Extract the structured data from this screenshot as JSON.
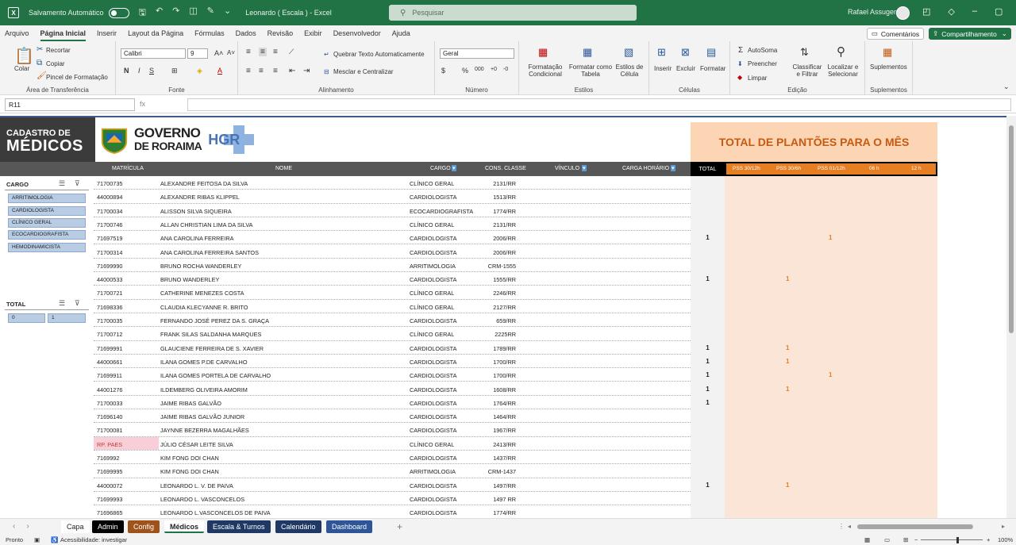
{
  "titlebar": {
    "app_icon": "excel-icon",
    "autosave": "Salvamento Automático",
    "doc_title": "Leonardo ( Escala )  -  Excel",
    "search_placeholder": "Pesquisar",
    "user": "Rafael Assugeni"
  },
  "menu": {
    "items": [
      "Arquivo",
      "Página Inicial",
      "Inserir",
      "Layout da Página",
      "Fórmulas",
      "Dados",
      "Revisão",
      "Exibir",
      "Desenvolvedor",
      "Ajuda"
    ],
    "active": "Página Inicial",
    "comments": "Comentários",
    "share": "Compartilhamento"
  },
  "ribbon": {
    "clipboard": {
      "name": "Área de Transferência",
      "paste": "Colar",
      "cut": "Recortar",
      "copy": "Copiar",
      "format_painter": "Pincel de Formatação"
    },
    "font": {
      "name": "Fonte",
      "family": "Calibri",
      "size": "9"
    },
    "alignment": {
      "name": "Alinhamento",
      "wrap": "Quebrar Texto Automaticamente",
      "merge": "Mesclar e Centralizar"
    },
    "number": {
      "name": "Número",
      "format": "Geral"
    },
    "styles": {
      "name": "Estilos",
      "conditional": "Formatação Condicional",
      "as_table": "Formatar como Tabela",
      "cell_styles": "Estilos de Célula"
    },
    "cells": {
      "name": "Células",
      "insert": "Inserir",
      "delete": "Excluir",
      "format": "Formatar"
    },
    "editing": {
      "name": "Edição",
      "autosum": "AutoSoma",
      "fill": "Preencher",
      "clear": "Limpar",
      "sort": "Classificar e Filtrar",
      "find": "Localizar e Selecionar"
    },
    "addins": {
      "name": "Suplementos",
      "label": "Suplementos"
    }
  },
  "formula": {
    "cell": "R11",
    "fx": "fx",
    "value": ""
  },
  "sheet": {
    "brand_l1": "CADASTRO DE",
    "brand_l2": "MÉDICOS",
    "gov_l1": "GOVERNO",
    "gov_l2": "DE RORAIMA",
    "hgr": "HGR",
    "plantoes_title": "TOTAL DE PLANTÕES PARA O MÊS",
    "headers": {
      "matricula": "MATRÍCULA",
      "nome": "NOME",
      "cargo": "CARGO",
      "cons_classe": "CONS. CLASSE",
      "vinculo": "VÍNCULO",
      "carga": "CARGA HORÁRIO",
      "total": "TOTAL",
      "pss30_12": "PSS 30/12h",
      "pss30_6": "PSS 30/6h",
      "pss01_12": "PSS 01/12h",
      "h06": "06 h",
      "h12": "12 h"
    },
    "rows": [
      {
        "mat": "71700735",
        "nome": "ALEXANDRE FEITOSA DA SILVA",
        "cargo": "CLÍNICO GERAL",
        "cons": "2131/RR",
        "total": "",
        "p30_12": "",
        "p30_6": "",
        "p01_12": ""
      },
      {
        "mat": "44000894",
        "nome": "ALEXANDRE RIBAS KLIPPEL",
        "cargo": "CARDIOLOGISTA",
        "cons": "1513/RR",
        "total": "",
        "p30_12": "",
        "p30_6": "",
        "p01_12": ""
      },
      {
        "mat": "71700034",
        "nome": "ALISSON SILVA SIQUEIRA",
        "cargo": "ECOCARDIOGRAFISTA",
        "cons": "1774/RR",
        "total": "",
        "p30_12": "",
        "p30_6": "",
        "p01_12": ""
      },
      {
        "mat": "71700746",
        "nome": "ALLAN CHRISTIAN LIMA DA SILVA",
        "cargo": "CLÍNICO GERAL",
        "cons": "2131/RR",
        "total": "",
        "p30_12": "",
        "p30_6": "",
        "p01_12": ""
      },
      {
        "mat": "71697519",
        "nome": "ANA CAROLINA FERREIRA",
        "cargo": "CARDIOLOGISTA",
        "cons": "2006/RR",
        "total": "1",
        "p30_12": "",
        "p30_6": "",
        "p01_12": "1"
      },
      {
        "mat": "71700314",
        "nome": "ANA CAROLINA FERREIRA SANTOS",
        "cargo": "CARDIOLOGISTA",
        "cons": "2006/RR",
        "total": "",
        "p30_12": "",
        "p30_6": "",
        "p01_12": ""
      },
      {
        "mat": "71699990",
        "nome": "BRUNO ROCHA WANDERLEY",
        "cargo": "ARRITIMOLOGIA",
        "cons": "CRM-1555",
        "total": "",
        "p30_12": "",
        "p30_6": "",
        "p01_12": ""
      },
      {
        "mat": "44000533",
        "nome": "BRUNO WANDERLEY",
        "cargo": "CARDIOLOGISTA",
        "cons": "1555/RR",
        "total": "1",
        "p30_12": "",
        "p30_6": "1",
        "p01_12": ""
      },
      {
        "mat": "71700721",
        "nome": "CATHERINE MENEZES COSTA",
        "cargo": "CLÍNICO GERAL",
        "cons": "2246/RR",
        "total": "",
        "p30_12": "",
        "p30_6": "",
        "p01_12": ""
      },
      {
        "mat": "71698336",
        "nome": "CLAUDIA KLECYANNE R. BRITO",
        "cargo": "CLÍNICO GERAL",
        "cons": "2127/RR",
        "total": "",
        "p30_12": "",
        "p30_6": "",
        "p01_12": ""
      },
      {
        "mat": "71700035",
        "nome": "FERNANDO JOSÉ PEREZ DA S. GRAÇA",
        "cargo": "CARDIOLOGISTA",
        "cons": "659/RR",
        "total": "",
        "p30_12": "",
        "p30_6": "",
        "p01_12": ""
      },
      {
        "mat": "71700712",
        "nome": "FRANK SILAS  SALDANHA MARQUES",
        "cargo": "CLÍNICO GERAL",
        "cons": "2225RR",
        "total": "",
        "p30_12": "",
        "p30_6": "",
        "p01_12": ""
      },
      {
        "mat": "71699991",
        "nome": "GLAUCIENE FERREIRA DE S. XAVIER",
        "cargo": "CARDIOLOGISTA",
        "cons": "1789/RR",
        "total": "1",
        "p30_12": "",
        "p30_6": "1",
        "p01_12": ""
      },
      {
        "mat": "44000661",
        "nome": "ILANA GOMES P.DE CARVALHO",
        "cargo": "CARDIOLOGISTA",
        "cons": "1700/RR",
        "total": "1",
        "p30_12": "",
        "p30_6": "1",
        "p01_12": ""
      },
      {
        "mat": "71699911",
        "nome": "ILANA GOMES PORTELA DE CARVALHO",
        "cargo": "CARDIOLOGISTA",
        "cons": "1700/RR",
        "total": "1",
        "p30_12": "",
        "p30_6": "",
        "p01_12": "1"
      },
      {
        "mat": "44001276",
        "nome": "ILDEMBERG OLIVEIRA AMORIM",
        "cargo": "CARDIOLOGISTA",
        "cons": "1608/RR",
        "total": "1",
        "p30_12": "",
        "p30_6": "1",
        "p01_12": ""
      },
      {
        "mat": "71700033",
        "nome": "JAIME RIBAS GALVÃO",
        "cargo": "CARDIOLOGISTA",
        "cons": "1764/RR",
        "total": "1",
        "p30_12": "",
        "p30_6": "",
        "p01_12": ""
      },
      {
        "mat": "71696140",
        "nome": "JAIME RIBAS GALVÃO JUNIOR",
        "cargo": "CARDIOLOGISTA",
        "cons": "1464/RR",
        "total": "",
        "p30_12": "",
        "p30_6": "",
        "p01_12": ""
      },
      {
        "mat": "71700081",
        "nome": "JAYNNE BEZERRA MAGALHÃES",
        "cargo": "CARDIOLOGISTA",
        "cons": "1967/RR",
        "total": "",
        "p30_12": "",
        "p30_6": "",
        "p01_12": ""
      },
      {
        "mat": "RP. PAES",
        "nome": "JÚLIO CÉSAR LEITE SILVA",
        "cargo": "CLÍNICO GERAL",
        "cons": "2413/RR",
        "total": "",
        "p30_12": "",
        "p30_6": "",
        "p01_12": ""
      },
      {
        "mat": "7169992",
        "nome": "KIM FONG DOI CHAN",
        "cargo": "CARDIOLOGISTA",
        "cons": "1437/RR",
        "total": "",
        "p30_12": "",
        "p30_6": "",
        "p01_12": ""
      },
      {
        "mat": "71699995",
        "nome": "KIM FONG DOI CHAN",
        "cargo": "ARRITIMOLOGIA",
        "cons": "CRM-1437",
        "total": "",
        "p30_12": "",
        "p30_6": "",
        "p01_12": ""
      },
      {
        "mat": "44000072",
        "nome": "LEONARDO L. V. DE PAIVA",
        "cargo": "CARDIOLOGISTA",
        "cons": "1497/RR",
        "total": "1",
        "p30_12": "",
        "p30_6": "1",
        "p01_12": ""
      },
      {
        "mat": "71699993",
        "nome": "LEONARDO L. VASCONCELOS",
        "cargo": "CARDIOLOGISTA",
        "cons": "1497 RR",
        "total": "",
        "p30_12": "",
        "p30_6": "",
        "p01_12": ""
      },
      {
        "mat": "71696865",
        "nome": "LEONARDO L.VASCONCELOS DE PAIVA",
        "cargo": "CARDIOLOGISTA",
        "cons": "1774/RR",
        "total": "",
        "p30_12": "",
        "p30_6": "",
        "p01_12": ""
      }
    ],
    "slicer_cargo": {
      "title": "CARGO",
      "items": [
        "ARRITIMOLOGIA",
        "CARDIOLOGISTA",
        "CLÍNICO GERAL",
        "ECOCARDIOGRAFISTA",
        "HEMODINAMICISTA"
      ]
    },
    "slicer_total": {
      "title": "TOTAL",
      "items": [
        "0",
        "1"
      ]
    }
  },
  "tabs": [
    {
      "label": "Capa",
      "color": "plain"
    },
    {
      "label": "Admin",
      "color": "#000000"
    },
    {
      "label": "Config",
      "color": "#a0521b"
    },
    {
      "label": "Médicos",
      "color": "active"
    },
    {
      "label": "Escala & Turnos",
      "color": "#1f3864"
    },
    {
      "label": "Calendário",
      "color": "#1f3864"
    },
    {
      "label": "Dashboard",
      "color": "#2e5597"
    }
  ],
  "status": {
    "ready": "Pronto",
    "accessibility": "Acessibilidade: investigar",
    "zoom": "100%"
  },
  "colors": {
    "excel_green": "#217346",
    "peach": "#fbe5d6",
    "orange": "#e67e22"
  }
}
